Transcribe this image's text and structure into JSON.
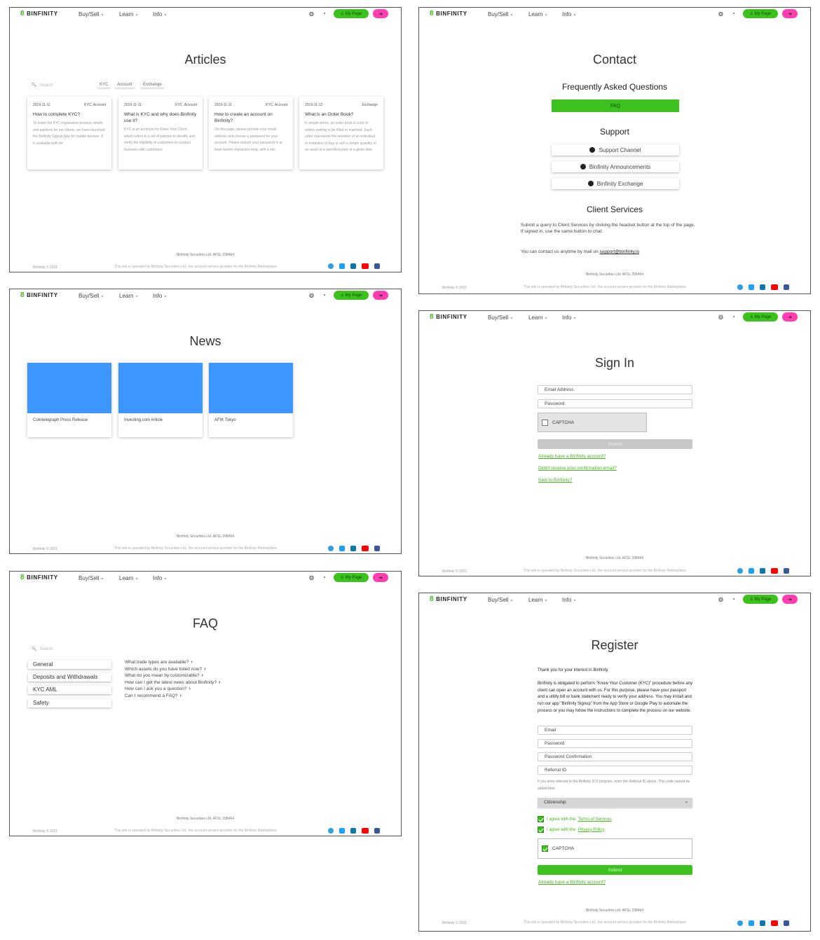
{
  "brand": {
    "logo_mark": "8",
    "name": "BINFINITY",
    "accent": "#3cc11f",
    "logout_color": "#ff3fb0"
  },
  "nav": {
    "buy_sell": "Buy/Sell",
    "learn": "Learn",
    "info": "Info",
    "caret": "⌄",
    "my_page": "My Page",
    "globe_icon": "globe-icon",
    "headset_icon": "headset-icon",
    "logout_icon": "logout-icon"
  },
  "footer": {
    "company": "Binfinity Securities Ltd. AFSL 298464",
    "copyright": "Binfinity © 2021",
    "operated": "This site is operated by Binfinity Securities Ltd., the account service provider for the Binfinity Marketplace."
  },
  "articles": {
    "title": "Articles",
    "search_placeholder": "Search",
    "filters": [
      "KYC",
      "Account",
      "Exchange"
    ],
    "cards": [
      {
        "date": "2019-11-11",
        "tags": "KYC, Account",
        "title": "How to complete KYC?",
        "desc": "To make the KYC registration process simple and painless for our clients, we have launched the Binfinity Signup App for mobile devices. It is available both for"
      },
      {
        "date": "2019-11-11",
        "tags": "KYC, Account",
        "title": "What is KYC and why does Binfinity use it?",
        "desc": "KYC is an acronym for Know Your Client, which refers to a set of policies to identify and verify the eligibility of customers to conduct business with customers."
      },
      {
        "date": "2019-11-11",
        "tags": "KYC, Account",
        "title": "How to create an account on Binfinity?",
        "desc": "On this page, please provide your email address and choose a password for your account. Please ensure your password is at least twelve characters long, with a mix"
      },
      {
        "date": "2019-11-12",
        "tags": "Exchange",
        "title": "What is an Order Book?",
        "desc": "In simple terms, an order book is a list of orders waiting to be filled or matched. Each order represents the intention of an individual or institution to buy or sell a certain quantity of an asset at a specified price at a given time."
      }
    ]
  },
  "news": {
    "title": "News",
    "items": [
      "Cointelegraph Press Release",
      "Investing.com Article",
      "AFIK Tokyo"
    ]
  },
  "faq": {
    "title": "FAQ",
    "search_placeholder": "Search",
    "categories": [
      "General",
      "Deposits and Withdrawals",
      "KYC AML",
      "Safety"
    ],
    "questions": [
      "What trade types are available?",
      "Which assets do you have listed now?",
      "What do you mean by customizable?",
      "How can I get the latest news about Binfinity?",
      "How can I ask you a question?",
      "Can I recommend a FAQ?"
    ]
  },
  "contact": {
    "title": "Contact",
    "faq_heading": "Frequently Asked Questions",
    "faq_button": "FAQ",
    "support_heading": "Support",
    "support_buttons": [
      "Support Channel",
      "Binfinity Announcements",
      "Binfinity Exchange"
    ],
    "client_heading": "Client Services",
    "client_text_1": "Submit a query to Client Services by clicking the headset button at the top of the page.",
    "client_text_2": "If signed in, use the same button to chat.",
    "mail_text": "You can contact us anytime by mail on",
    "mail_link": "support@binfinity.io"
  },
  "signin": {
    "title": "Sign In",
    "email": "Email Address",
    "password": "Password",
    "captcha": "CAPTCHA",
    "submit": "Submit",
    "links": [
      "Already have a Binfinity account?",
      "Didn't receive your confirmation email?",
      "New to Binfinity?"
    ]
  },
  "register": {
    "title": "Register",
    "intro": "Thank you for your interest in Binfinity.",
    "kyc_text": "Binfinity is obligated to perform \"Know Your Customer (KYC)\" procedure before any client can open an account with us. For this purpose, please have your passport and a utility bill or bank statement ready to verify your address. You may install and run our app \"Binfinity Signup\" from the App Store or Google Play to automate the process or you may follow the instructions to complete the process on our website.",
    "fields": [
      "Email",
      "Password",
      "Password Confirmation",
      "Referral ID"
    ],
    "referral_note": "If you were referred to the Binfinity ICO program, enter the Referral ID above. This code cannot be added later.",
    "citizenship": "Citizenship",
    "agree_terms_prefix": "I agree with the",
    "agree_terms_link": "Terms of Services",
    "agree_privacy_prefix": "I agree with the",
    "agree_privacy_link": "Privacy Policy",
    "captcha": "CAPTCHA",
    "submit": "Submit",
    "already": "Already have a Binfinity account?"
  }
}
